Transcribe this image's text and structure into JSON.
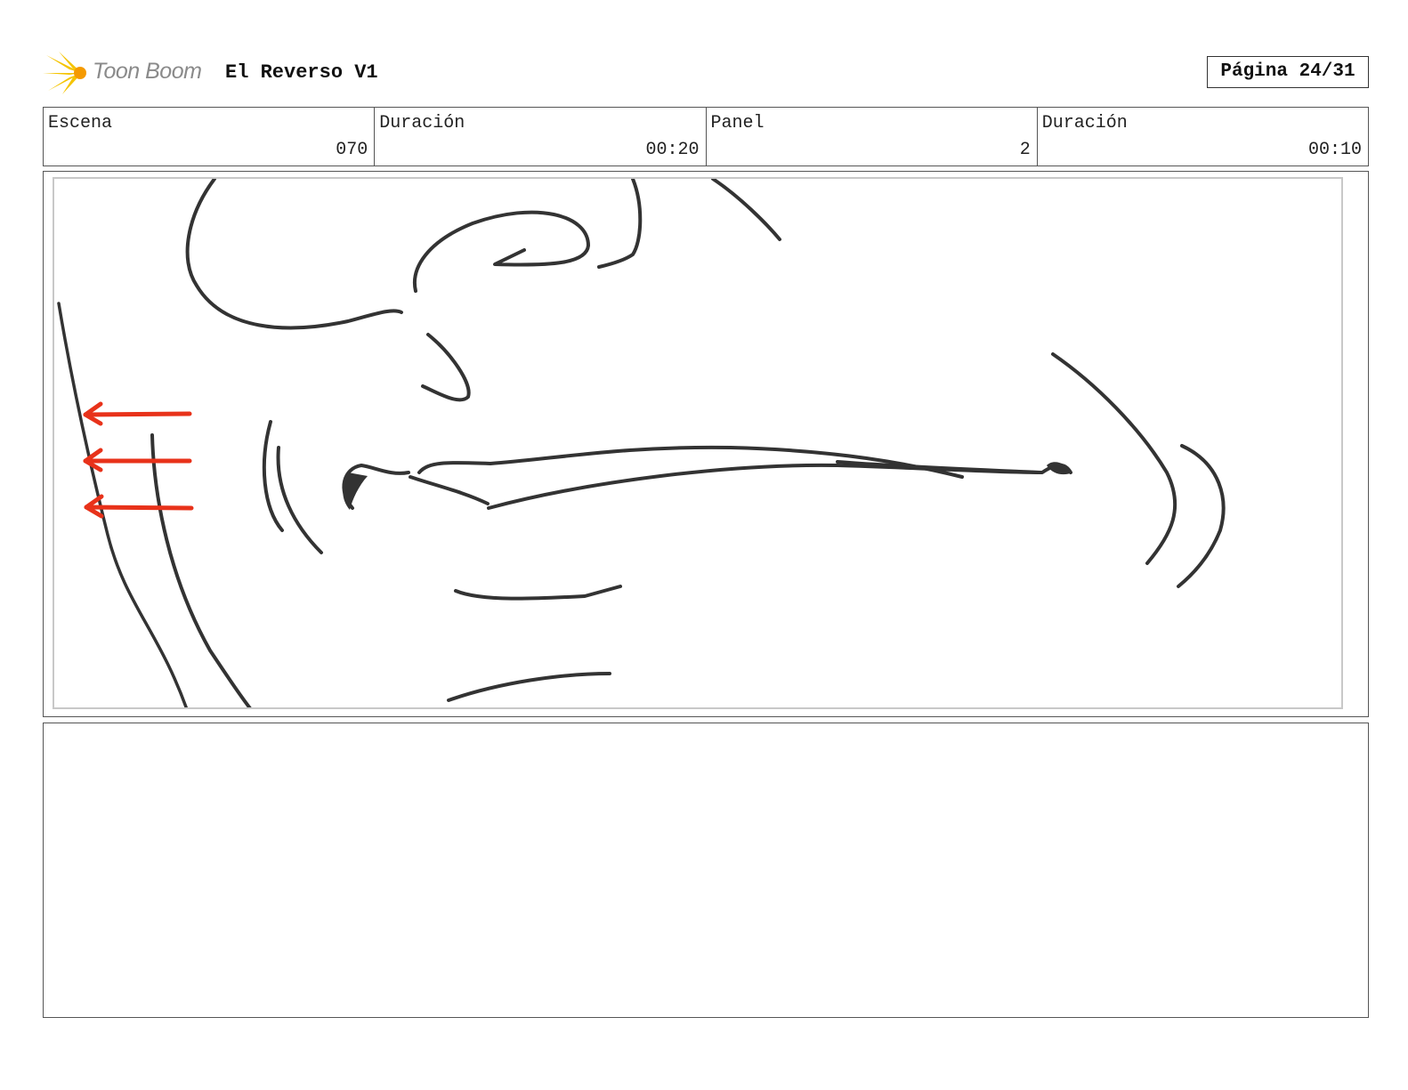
{
  "header": {
    "logo_text": "Toon Boom",
    "project_title": "El Reverso V1",
    "page_label": "Página 24/31"
  },
  "info": [
    {
      "label": "Escena",
      "value": "070"
    },
    {
      "label": "Duración",
      "value": "00:20"
    },
    {
      "label": "Panel",
      "value": "2"
    },
    {
      "label": "Duración",
      "value": "00:10"
    }
  ],
  "sketch": {
    "subject": "close-up-face-sketch",
    "line_color": "#333333",
    "arrow_color": "#e8321a"
  },
  "notes": {
    "text": ""
  }
}
